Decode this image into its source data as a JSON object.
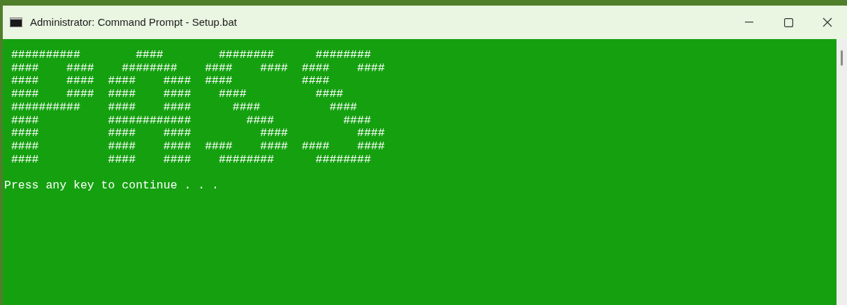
{
  "window": {
    "title": "Administrator: Command Prompt - Setup.bat"
  },
  "console": {
    "art": [
      " ##########        ####        ########      ########",
      " ####    ####    ########    ####    ####  ####    ####",
      " ####    ####  ####    ####  ####          ####",
      " ####    ####  ####    ####    ####          ####",
      " ##########    ####    ####      ####          ####",
      " ####          ############        ####          ####",
      " ####          ####    ####          ####          ####",
      " ####          ####    ####  ####    ####  ####    ####",
      " ####          ####    ####    ########      ########"
    ],
    "prompt": "Press any key to continue . . ."
  }
}
